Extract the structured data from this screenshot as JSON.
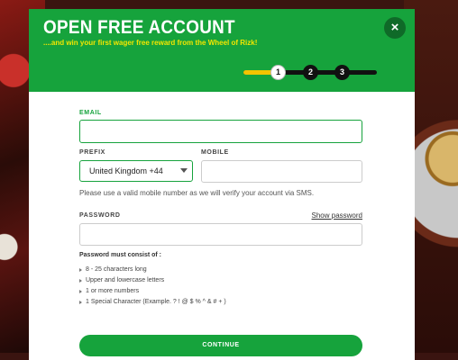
{
  "modal": {
    "title": "OPEN FREE ACCOUNT",
    "subtitle": "....and win your first wager free reward from the Wheel of Rizk!",
    "close_icon": "×"
  },
  "steps": [
    {
      "label": "1",
      "state": "active"
    },
    {
      "label": "2",
      "state": "pending"
    },
    {
      "label": "3",
      "state": "pending"
    }
  ],
  "form": {
    "email_label": "EMAIL",
    "email_value": "",
    "prefix_label": "PREFIX",
    "prefix_value": "United Kingdom +44",
    "mobile_label": "MOBILE",
    "mobile_value": "",
    "mobile_hint": "Please use a valid mobile number as we will verify your account via SMS.",
    "password_label": "PASSWORD",
    "show_password": "Show password",
    "password_value": "",
    "rules_title": "Password must consist of :",
    "rules": [
      "8 - 25 characters long",
      "Upper and lowercase letters",
      "1 or more numbers",
      "1 Special Character (Example. ? ! @ $ % ^ & # + )"
    ],
    "continue_label": "CONTINUE"
  },
  "colors": {
    "brand_green": "#16a33c",
    "accent_yellow": "#f2c400"
  }
}
